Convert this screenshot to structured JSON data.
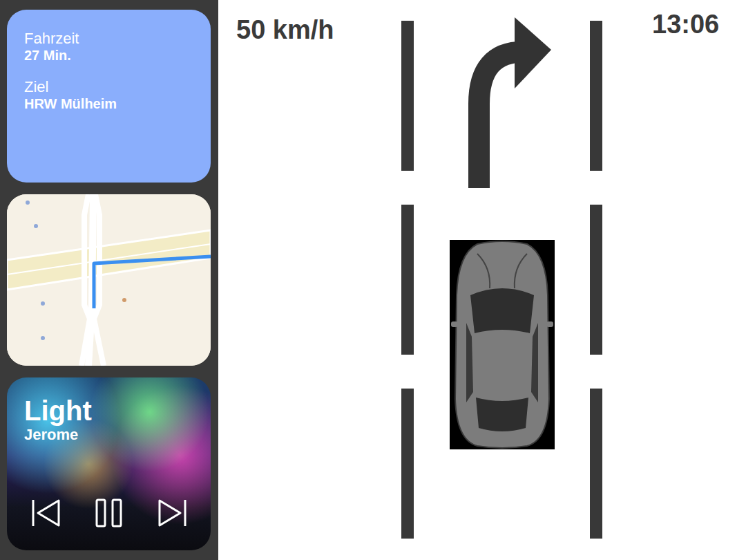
{
  "trip": {
    "items": [
      {
        "label": "Fahrzeit",
        "value": "27 Min."
      },
      {
        "label": "Ziel",
        "value": "HRW Mülheim"
      }
    ]
  },
  "music": {
    "title": "Light",
    "artist": "Jerome",
    "playing": true
  },
  "speed": "50 km/h",
  "clock": "13:06"
}
